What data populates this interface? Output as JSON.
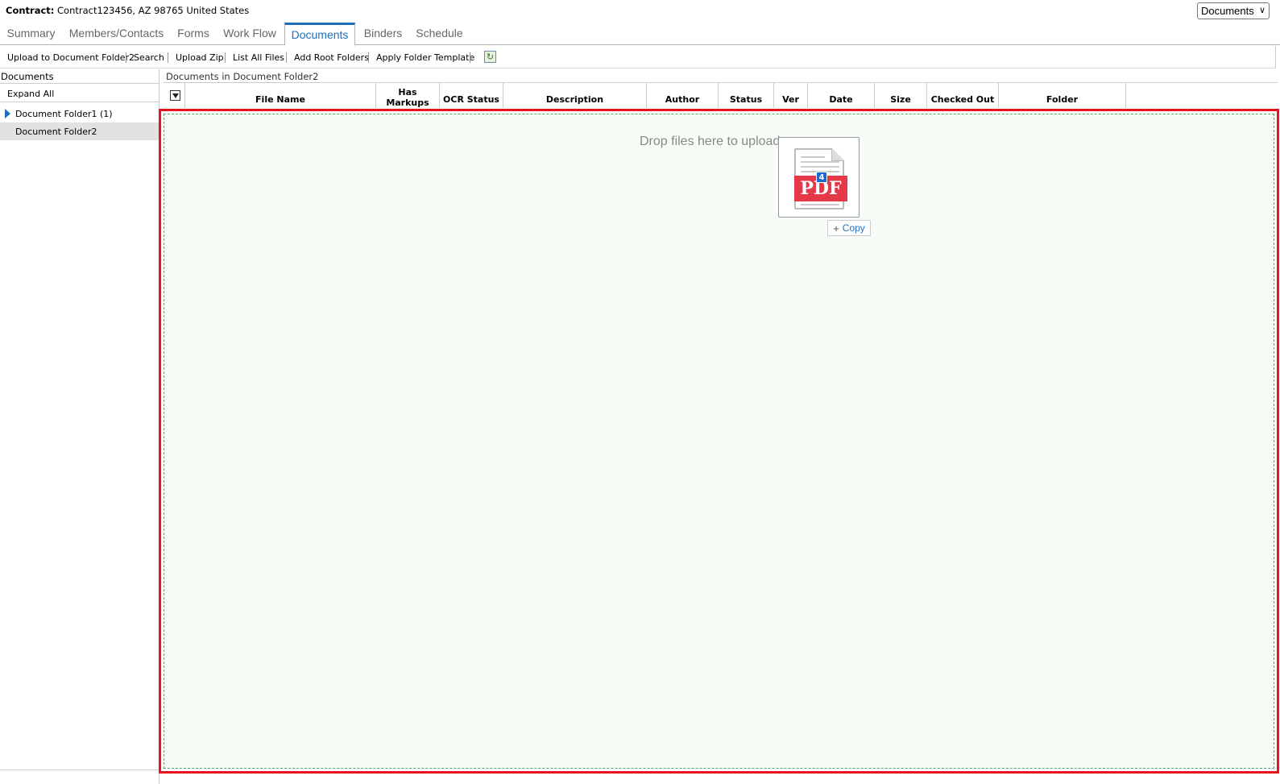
{
  "header": {
    "contract_label": "Contract:",
    "contract_value": "Contract123456, AZ 98765 United States",
    "view_select": "Documents"
  },
  "tabs": [
    {
      "label": "Summary"
    },
    {
      "label": "Members/Contacts"
    },
    {
      "label": "Forms"
    },
    {
      "label": "Work Flow"
    },
    {
      "label": "Documents",
      "active": true
    },
    {
      "label": "Binders"
    },
    {
      "label": "Schedule"
    }
  ],
  "toolbar": {
    "upload_folder": "Upload to Document Folder2",
    "search": "Search",
    "upload_zip": "Upload Zip",
    "list_all": "List All Files",
    "add_root": "Add Root Folders",
    "apply_template": "Apply Folder Template",
    "refresh_icon": "refresh-icon"
  },
  "left": {
    "title": "Documents",
    "expand_all": "Expand All",
    "folders": [
      {
        "label": "Document Folder1 (1)",
        "collapsed": true
      },
      {
        "label": "Document Folder2",
        "selected": true
      }
    ]
  },
  "right": {
    "title": "Documents in Document Folder2",
    "columns": {
      "file_name": "File Name",
      "has_markups": "Has Markups",
      "ocr_status": "OCR Status",
      "description": "Description",
      "author": "Author",
      "status": "Status",
      "ver": "Ver",
      "date": "Date",
      "size": "Size",
      "checked_out": "Checked Out",
      "folder": "Folder"
    }
  },
  "drop_zone": {
    "text": "Drop files here to upload",
    "drag_badge": "4",
    "drag_file_type": "PDF",
    "copy_label": "Copy",
    "copy_plus": "+"
  },
  "colors": {
    "accent": "#1e6fbf",
    "drop_border": "#e8141c",
    "pdf_red": "#e5394a"
  }
}
